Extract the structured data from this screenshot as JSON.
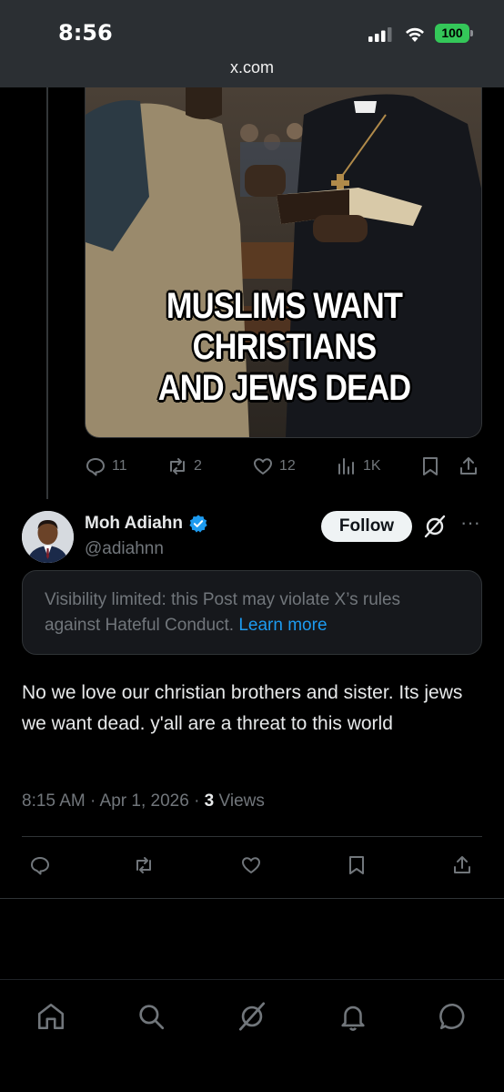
{
  "status_bar": {
    "time": "8:56",
    "battery": "100",
    "url": "x.com"
  },
  "quoted_media": {
    "meme_lines": [
      "MUSLIMS WANT",
      "CHRISTIANS",
      "AND JEWS DEAD"
    ]
  },
  "quoted_actions": {
    "replies": "11",
    "reposts": "2",
    "likes": "12",
    "views": "1K"
  },
  "author": {
    "name": "Moh Adiahn",
    "handle": "@adiahnn",
    "follow_label": "Follow",
    "verified": true
  },
  "notice": {
    "text": "Visibility limited: this Post may violate X’s rules against Hateful Conduct. ",
    "link": "Learn more"
  },
  "post": {
    "text": "No we love our christian brothers and sister. Its jews we want dead. y'all are a threat to this world",
    "time": "8:15 AM · Apr 1, 2026 · ",
    "views_count": "3",
    "views_label": " Views"
  },
  "colors": {
    "background": "#000000",
    "accent_blue": "#1d9bf0",
    "muted": "#71767b",
    "battery_green": "#34c759"
  },
  "icons": {
    "nav": [
      "home-icon",
      "search-icon",
      "grok-icon",
      "notifications-icon",
      "messages-icon"
    ]
  }
}
